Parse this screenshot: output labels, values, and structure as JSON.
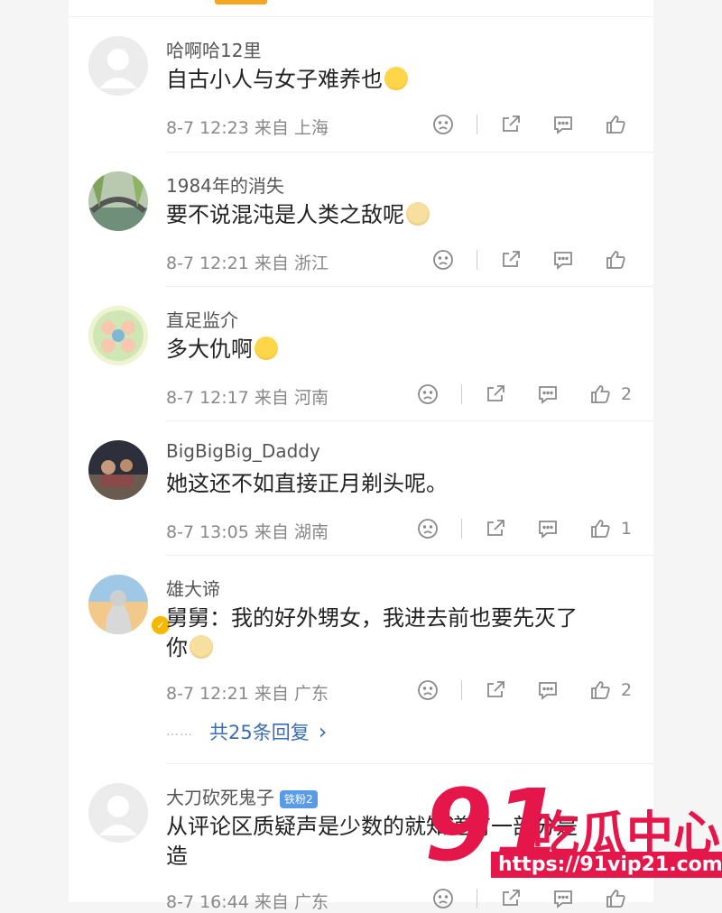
{
  "comments": [
    {
      "user": "哈啊哈12里",
      "text": "自古小人与女子难养也",
      "emoji": "grin",
      "time": "8-7 12:23",
      "from": "来自",
      "location": "上海",
      "likes": ""
    },
    {
      "user": "1984年的消失",
      "text": "要不说混沌是人类之敌呢",
      "emoji": "doge",
      "time": "8-7 12:21",
      "from": "来自",
      "location": "浙江",
      "likes": ""
    },
    {
      "user": "直足监介",
      "text": "多大仇啊",
      "emoji": "laugh",
      "time": "8-7 12:17",
      "from": "来自",
      "location": "河南",
      "likes": "2"
    },
    {
      "user": "BigBigBig_Daddy",
      "text": "她这还不如直接正月剃头呢。",
      "emoji": "",
      "time": "8-7 13:05",
      "from": "来自",
      "location": "湖南",
      "likes": "1"
    },
    {
      "user": "雄大谛",
      "text_line1": "舅舅：我的好外甥女，我进去前也要先灭了",
      "text_line2": "你",
      "emoji": "doge",
      "time": "8-7 12:21",
      "from": "来自",
      "location": "广东",
      "likes": "2"
    },
    {
      "user": "大刀砍死鬼子",
      "badge": "铁粉2",
      "text_line1": "从评论区质疑声是少数的",
      "text_line1_tail": "就知道有一部分是",
      "text_line2": "造",
      "time": "8-7 16:44",
      "from": "来自",
      "location": "广东",
      "likes": ""
    }
  ],
  "replies": {
    "dots": "……",
    "label": "共25条回复",
    "chevron": "›"
  },
  "watermark": {
    "number": "91",
    "brand": "吃瓜中心",
    "url": "https://91vip21.com"
  },
  "colors": {
    "accent": "#f5a623",
    "link": "#3b6db3",
    "watermark": "#e4164a"
  }
}
